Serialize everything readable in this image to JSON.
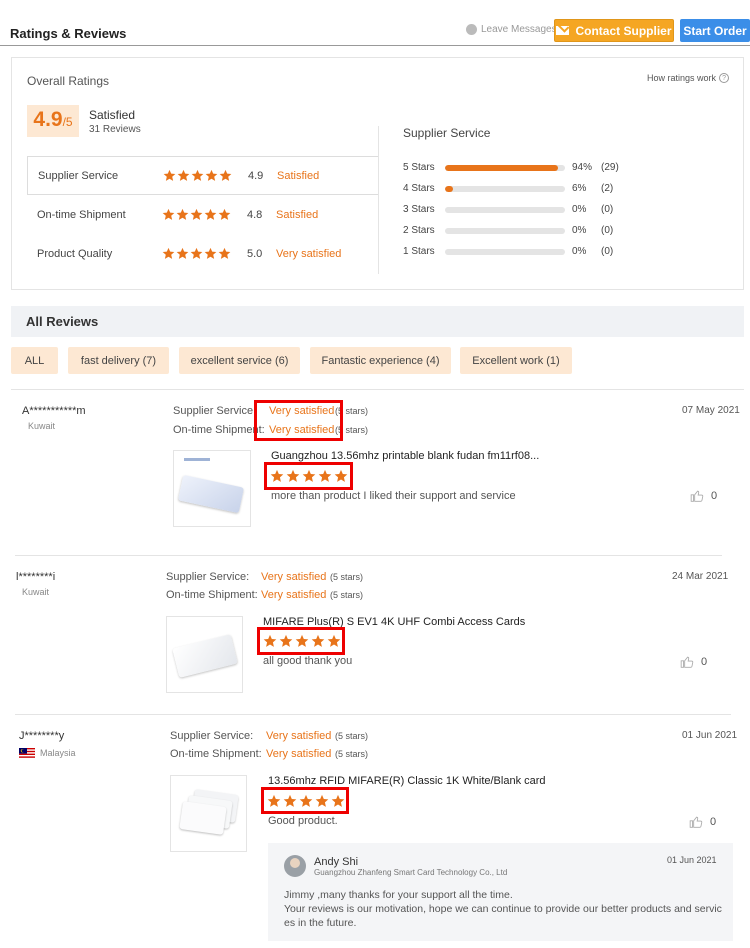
{
  "header": {
    "title": "Ratings & Reviews",
    "leave_messages": "Leave Messages",
    "contact_supplier": "Contact Supplier",
    "start_order": "Start Order"
  },
  "overall": {
    "title": "Overall Ratings",
    "how_link": "How ratings work",
    "score": "4.9",
    "score_max": "/5",
    "label": "Satisfied",
    "reviews": "31 Reviews",
    "categories": [
      {
        "label": "Supplier Service",
        "value": "4.9",
        "word": "Satisfied",
        "stars": 5
      },
      {
        "label": "On-time Shipment",
        "value": "4.8",
        "word": "Satisfied",
        "stars": 5
      },
      {
        "label": "Product Quality",
        "value": "5.0",
        "word": "Very satisfied",
        "stars": 5
      }
    ]
  },
  "supplier_service": {
    "title": "Supplier Service",
    "rows": [
      {
        "label": "5 Stars",
        "pct": "94%",
        "count": "(29)",
        "fraction": 0.94
      },
      {
        "label": "4 Stars",
        "pct": "6%",
        "count": "(2)",
        "fraction": 0.06
      },
      {
        "label": "3 Stars",
        "pct": "0%",
        "count": "(0)",
        "fraction": 0
      },
      {
        "label": "2 Stars",
        "pct": "0%",
        "count": "(0)",
        "fraction": 0
      },
      {
        "label": "1 Stars",
        "pct": "0%",
        "count": "(0)",
        "fraction": 0
      }
    ]
  },
  "all_reviews": {
    "title": "All Reviews",
    "filters": [
      "ALL",
      "fast delivery (7)",
      "excellent service (6)",
      "Fantastic experience (4)",
      "Excellent work (1)"
    ]
  },
  "reviews": [
    {
      "name": "A***********m",
      "country": "Kuwait",
      "supplier_label": "Supplier Service:",
      "supplier_value": "Very satisfied",
      "supplier_stars": "(5 stars)",
      "shipment_label": "On-time Shipment:",
      "shipment_value": "Very satisfied",
      "shipment_stars": "(5 stars)",
      "date": "07 May 2021",
      "product": "Guangzhou 13.56mhz printable blank fudan fm11rf08...",
      "product_stars": 5,
      "text": "more than product I liked their support and service",
      "likes": "0"
    },
    {
      "name": "l********i",
      "country": "Kuwait",
      "supplier_label": "Supplier Service:",
      "supplier_value": "Very satisfied",
      "supplier_stars": "(5 stars)",
      "shipment_label": "On-time Shipment:",
      "shipment_value": "Very satisfied",
      "shipment_stars": "(5 stars)",
      "date": "24 Mar 2021",
      "product": "MIFARE Plus(R) S EV1 4K UHF Combi Access Cards",
      "product_stars": 5,
      "text": "all good thank you",
      "likes": "0"
    },
    {
      "name": "J********y",
      "country": "Malaysia",
      "supplier_label": "Supplier Service:",
      "supplier_value": "Very satisfied",
      "supplier_stars": "(5 stars)",
      "shipment_label": "On-time Shipment:",
      "shipment_value": "Very satisfied",
      "shipment_stars": "(5 stars)",
      "date": "01 Jun 2021",
      "product": "13.56mhz RFID MIFARE(R) Classic 1K White/Blank card",
      "product_stars": 5,
      "text": "Good product.",
      "likes": "0"
    }
  ],
  "reply": {
    "name": "Andy Shi",
    "company": "Guangzhou Zhanfeng Smart Card Technology Co., Ltd",
    "date": "01 Jun 2021",
    "line1": "Jimmy ,many thanks for your support all the time.",
    "line2": "Your reviews is our motivation, hope we can continue to provide our better products and servic",
    "line3": "es in the future."
  },
  "colors": {
    "accent": "#e8741a",
    "contact": "#f5a623",
    "order": "#3b8ee8",
    "highlight": "#e00000"
  },
  "icons": [
    "message-icon",
    "mail-icon",
    "help-icon",
    "star-icon",
    "thumbs-up-icon",
    "malaysia-flag-icon"
  ]
}
